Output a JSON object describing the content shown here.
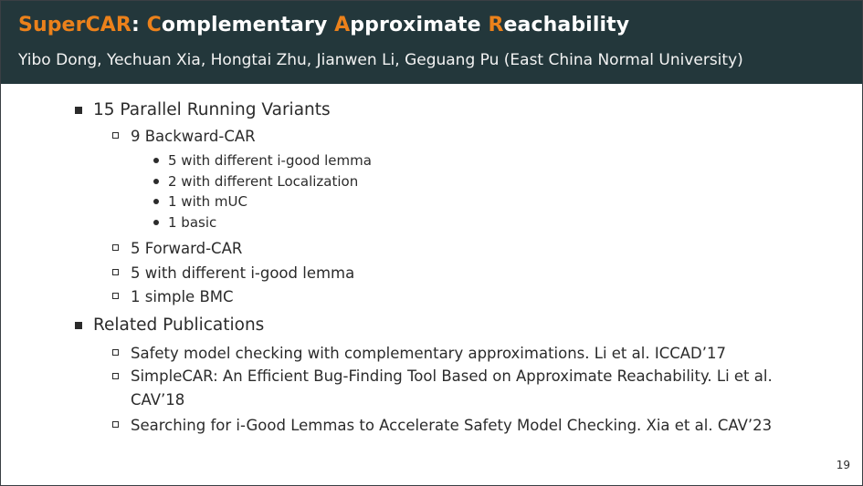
{
  "header": {
    "title_parts": [
      {
        "text": "Super",
        "accent": true
      },
      {
        "text": "CAR",
        "accent": true
      },
      {
        "text": ": ",
        "accent": false
      },
      {
        "text": "C",
        "accent": true
      },
      {
        "text": "omplementary ",
        "accent": false
      },
      {
        "text": "A",
        "accent": true
      },
      {
        "text": "pproximate ",
        "accent": false
      },
      {
        "text": "R",
        "accent": true
      },
      {
        "text": "eachability",
        "accent": false
      }
    ],
    "authors": "Yibo Dong, Yechuan Xia, Hongtai Zhu, Jianwen Li, Geguang Pu (East China Normal University)"
  },
  "content": {
    "section1": {
      "label": "15 Parallel Running Variants",
      "backward": {
        "label": "9 Backward-CAR",
        "items": [
          "5 with different i-good lemma",
          "2 with different Localization",
          "1 with mUC",
          "1 basic"
        ]
      },
      "forward": "5 Forward-CAR",
      "lemma": "5 with different i-good lemma",
      "bmc": "1 simple BMC"
    },
    "section2": {
      "label": "Related Publications",
      "pubs": [
        "Safety model checking with complementary approximations.  Li et al. ICCAD’17",
        "SimpleCAR: An Efficient Bug-Finding Tool Based on Approximate Reachability. Li et al. CAV’18",
        "Searching for i-Good Lemmas to Accelerate Safety Model Checking.  Xia et al. CAV’23"
      ]
    }
  },
  "footer": {
    "page_number": "19"
  },
  "colors": {
    "header_bg": "#23373b",
    "accent": "#eb811b",
    "text": "#2b2b2b"
  }
}
